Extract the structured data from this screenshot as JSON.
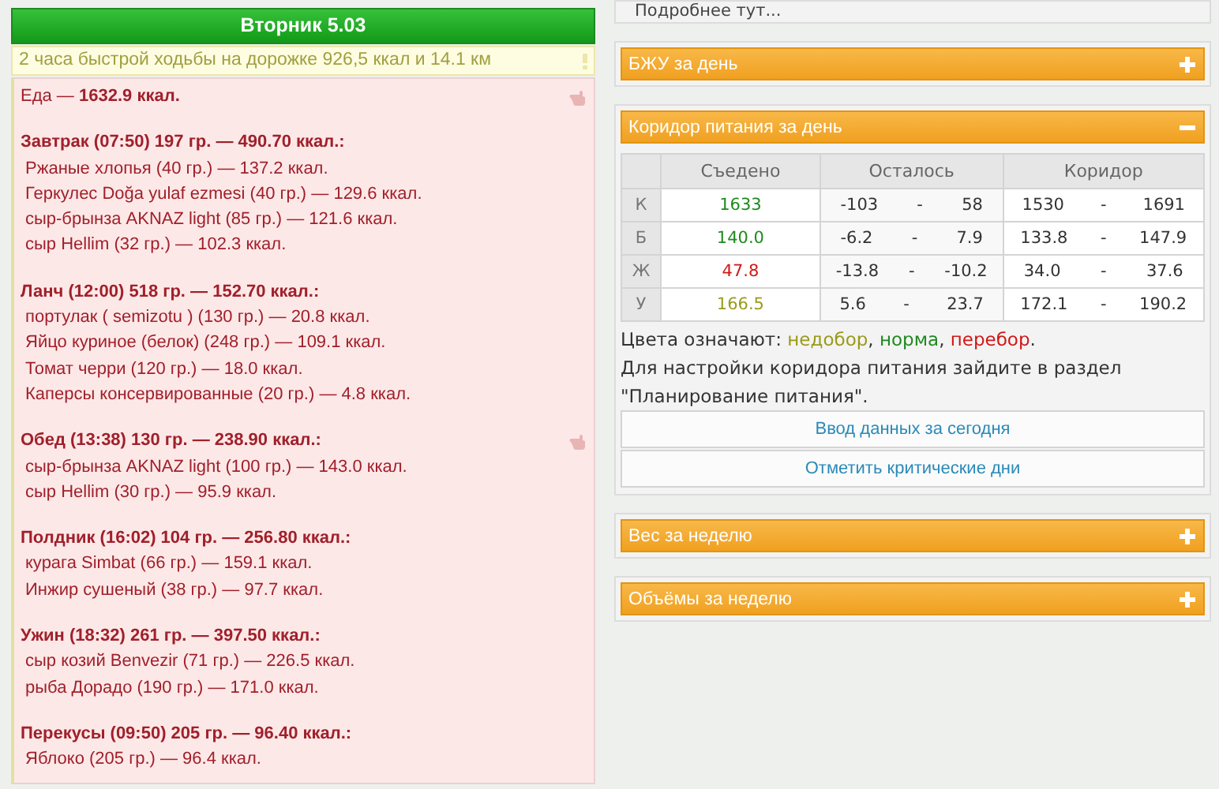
{
  "day": {
    "title": "Вторник 5.03",
    "activity": "2 часа быстрой ходьбы на дорожке 926,5 ккал и 14.1 км",
    "food_total": {
      "text": "Еда — **1632.9 ккал.**",
      "hand_icon": true
    },
    "meals": [
      {
        "title": "Завтрак (07:50) 197 гр. — 490.70 ккал.:",
        "hand_icon": false,
        "items": [
          "Ржаные хлопья (40 гр.) — 137.2 ккал.",
          "Геркулес Doğa yulaf ezmesi (40 гр.) — 129.6 ккал.",
          "сыр-брынза AKNAZ light (85 гр.) — 121.6 ккал.",
          "сыр Hellim (32 гр.) — 102.3 ккал."
        ]
      },
      {
        "title": "Ланч (12:00) 518 гр. — 152.70 ккал.:",
        "hand_icon": false,
        "items": [
          "портулак ( semizotu ) (130 гр.) — 20.8 ккал.",
          "Яйцо куриное (белок) (248 гр.) — 109.1 ккал.",
          "Томат черри (120 гр.) — 18.0 ккал.",
          "Каперсы консервированные (20 гр.) — 4.8 ккал."
        ]
      },
      {
        "title": "Обед (13:38) 130 гр. — 238.90 ккал.:",
        "hand_icon": true,
        "items": [
          "сыр-брынза AKNAZ light (100 гр.) — 143.0 ккал.",
          "сыр Hellim (30 гр.) — 95.9 ккал."
        ]
      },
      {
        "title": "Полдник (16:02) 104 гр. — 256.80 ккал.:",
        "hand_icon": false,
        "items": [
          "курага Simbat (66 гр.) — 159.1 ккал.",
          "Инжир сушеный (38 гр.) — 97.7 ккал."
        ]
      },
      {
        "title": "Ужин (18:32) 261 гр. — 397.50 ккал.:",
        "hand_icon": false,
        "items": [
          "сыр козий Benvezir (71 гр.) — 226.5 ккал.",
          "рыба Дорадо (190 гр.) — 171.0 ккал."
        ]
      },
      {
        "title": "Перекусы (09:50) 205 гр. — 96.40 ккал.:",
        "hand_icon": false,
        "items": [
          "Яблоко (205 гр.) — 96.4 ккал."
        ]
      }
    ]
  },
  "info_link": "Подробнее тут...",
  "panels": [
    {
      "kind": "plain",
      "title": "БЖУ за день",
      "expanded": false
    },
    {
      "kind": "corridor",
      "title": "Коридор питания за день",
      "expanded": true,
      "table": {
        "columns": [
          "Съедено",
          "Осталось",
          "Коридор"
        ],
        "rows": [
          {
            "label": "К",
            "eaten": "1633",
            "color": "#1f8a1f",
            "remaining": [
              "-103",
              "-",
              "58"
            ],
            "corridor": [
              "1530",
              "-",
              "1691"
            ]
          },
          {
            "label": "Б",
            "eaten": "140.0",
            "color": "#1f8a1f",
            "remaining": [
              "-6.2",
              "-",
              "7.9"
            ],
            "corridor": [
              "133.8",
              "-",
              "147.9"
            ]
          },
          {
            "label": "Ж",
            "eaten": "47.8",
            "color": "#d01818",
            "remaining": [
              "-13.8",
              "-",
              "-10.2"
            ],
            "corridor": [
              "34.0",
              "-",
              "37.6"
            ]
          },
          {
            "label": "У",
            "eaten": "166.5",
            "color": "#9a9a1a",
            "remaining": [
              "5.6",
              "-",
              "23.7"
            ],
            "corridor": [
              "172.1",
              "-",
              "190.2"
            ]
          }
        ]
      },
      "legend": [
        {
          "text": "Цвета означают: "
        },
        {
          "text": "недобор",
          "color": "#9a9a1a"
        },
        {
          "text": ", "
        },
        {
          "text": "норма",
          "color": "#1f8a1f"
        },
        {
          "text": ", "
        },
        {
          "text": "перебор",
          "color": "#d01818"
        },
        {
          "text": "."
        }
      ],
      "note": "Для настройки коридора питания зайдите в раздел \"Планирование питания\".",
      "buttons": [
        "Ввод данных за сегодня",
        "Отметить критические дни"
      ]
    },
    {
      "kind": "plain",
      "title": "Вес за неделю",
      "expanded": false
    },
    {
      "kind": "plain",
      "title": "Объёмы за неделю",
      "expanded": false
    }
  ]
}
